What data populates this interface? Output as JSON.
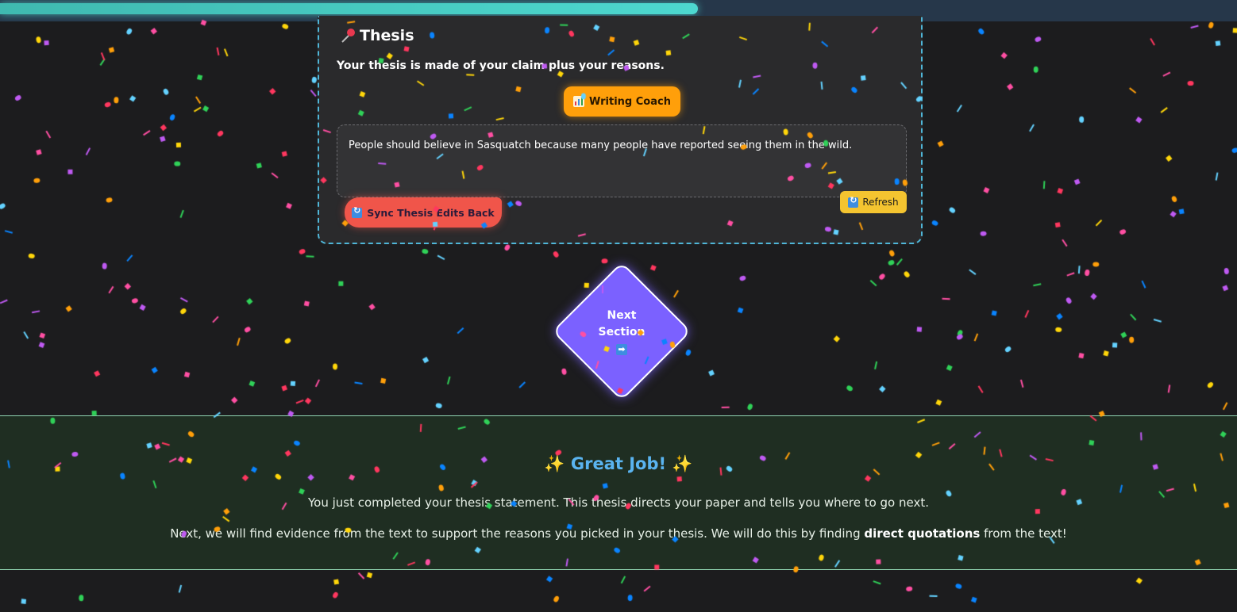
{
  "progress": {
    "percent": 56.4,
    "color": "#4dd8cf"
  },
  "thesis": {
    "heading": "Thesis",
    "subheading": "Your thesis is made of your claim plus your reasons.",
    "coach_button": "Writing Coach",
    "text": "People should believe in Sasquatch because many people have reported seeing them in the wild.",
    "refresh_button": "Refresh",
    "sync_button": "Sync Thesis Edits Back"
  },
  "next": {
    "line1": "Next",
    "line2": "Section"
  },
  "completion": {
    "title": "Great Job!",
    "line1": "You just completed your thesis statement. This thesis directs your paper and tells you where to go next.",
    "line2_before": "Next, we will find evidence from the text to support the reasons you picked in your thesis. We will do this by finding ",
    "line2_bold": "direct quotations",
    "line2_after": " from the text!"
  },
  "colors": {
    "accent_teal": "#4dd8cf",
    "coach_orange": "#ff9f0a",
    "sync_red": "#f0554a",
    "refresh_yellow": "#f4c430",
    "next_purple": "#7b61ff",
    "title_blue": "#5ab4f0",
    "confetti": [
      "#ff4fa3",
      "#ffd60a",
      "#30d158",
      "#0a84ff",
      "#bf5af2",
      "#ff9f0a",
      "#64d2ff",
      "#ff375f"
    ]
  }
}
